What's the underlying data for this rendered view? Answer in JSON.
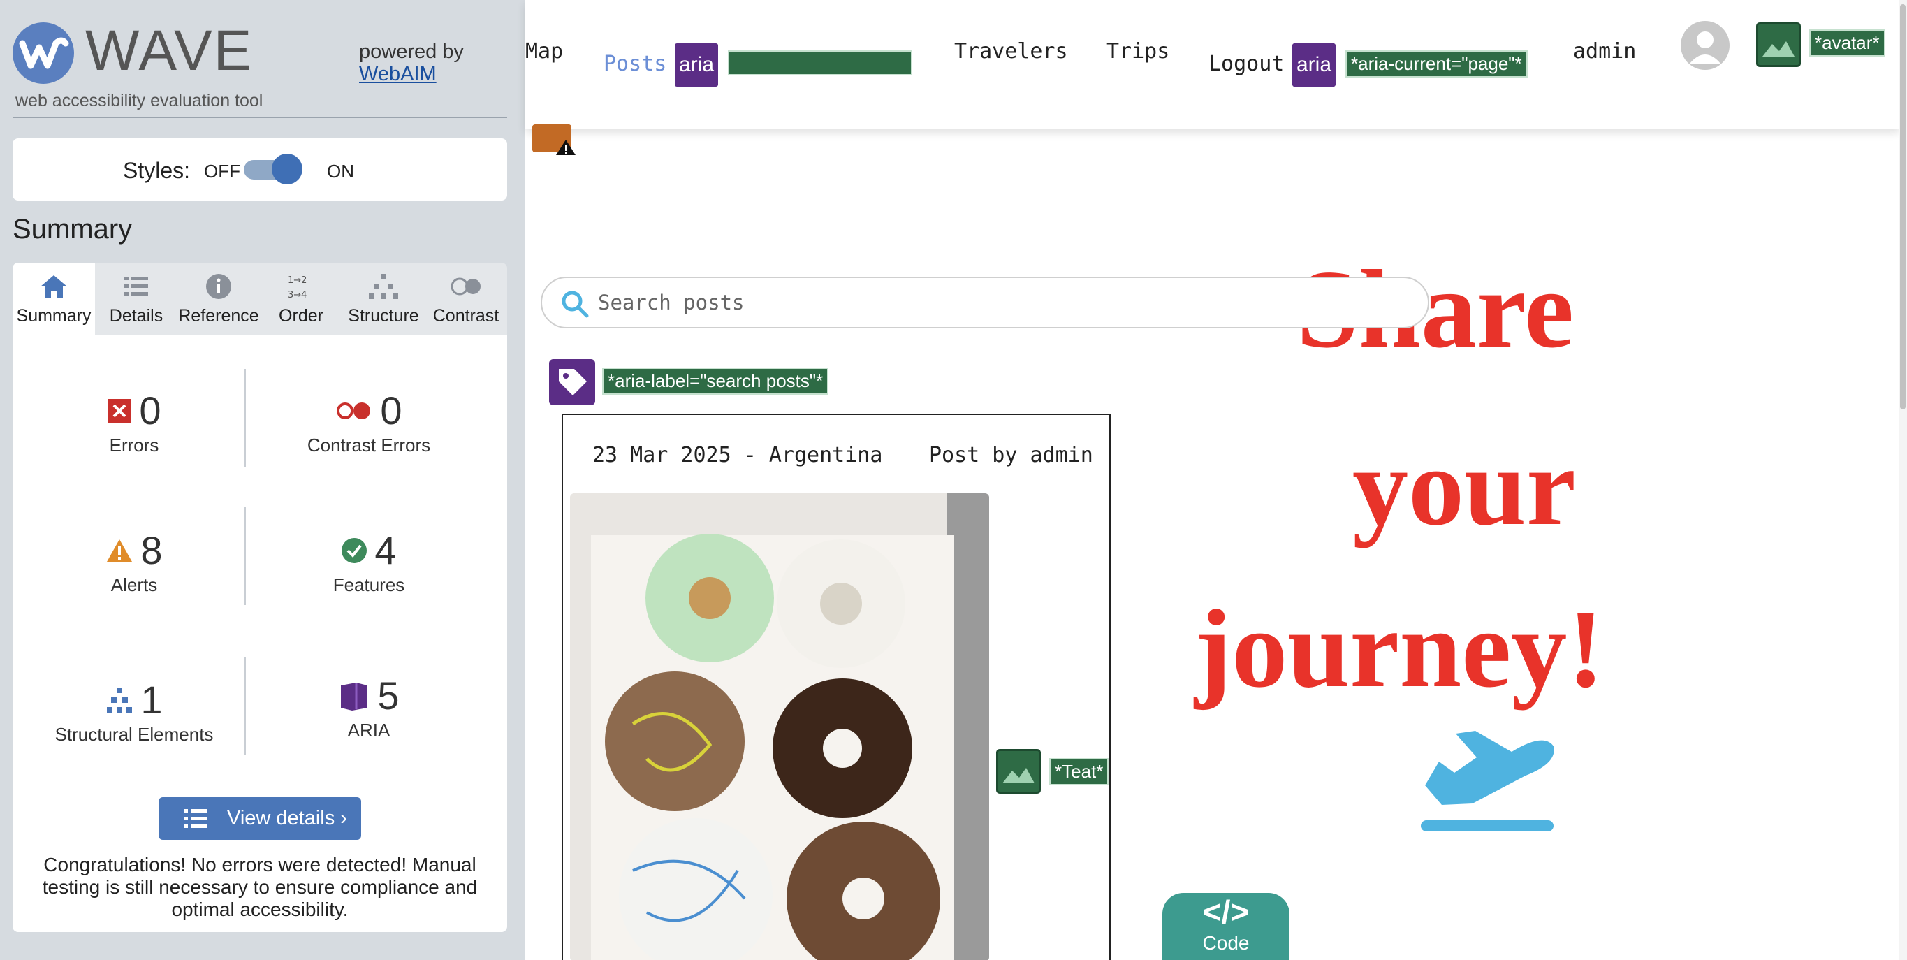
{
  "wave": {
    "brand": "WAVE",
    "tagline": "web accessibility evaluation tool",
    "powered_by": "powered by",
    "webaim_link": "WebAIM",
    "styles_label": "Styles:",
    "styles_off": "OFF",
    "styles_on": "ON",
    "styles_enabled": true,
    "summary_heading": "Summary",
    "tabs": [
      {
        "label": "Summary",
        "icon": "home-icon",
        "active": true
      },
      {
        "label": "Details",
        "icon": "list-icon",
        "active": false
      },
      {
        "label": "Reference",
        "icon": "info-icon",
        "active": false
      },
      {
        "label": "Order",
        "icon": "order-icon",
        "active": false
      },
      {
        "label": "Structure",
        "icon": "structure-icon",
        "active": false
      },
      {
        "label": "Contrast",
        "icon": "contrast-icon",
        "active": false
      }
    ],
    "stats": {
      "errors": {
        "count": "0",
        "label": "Errors"
      },
      "contrast_errors": {
        "count": "0",
        "label": "Contrast Errors"
      },
      "alerts": {
        "count": "8",
        "label": "Alerts"
      },
      "features": {
        "count": "4",
        "label": "Features"
      },
      "structural": {
        "count": "1",
        "label": "Structural Elements"
      },
      "aria": {
        "count": "5",
        "label": "ARIA"
      }
    },
    "view_details": "View details ›",
    "congrats": "Congratulations! No errors were detected! Manual testing is still necessary to ensure compliance and optimal accessibility."
  },
  "site": {
    "nav": {
      "map": "Map",
      "posts": "Posts",
      "travelers": "Travelers",
      "trips": "Trips",
      "logout": "Logout",
      "admin": "admin"
    },
    "aria_badge": "aria",
    "aria_current_tag": "*aria-current=\"page\"*",
    "avatar_tag": "*avatar*",
    "search_placeholder": "Search posts",
    "aria_label_tag": "*aria-label=\"search posts\"*",
    "hero": {
      "line1": "Share",
      "line2": "your",
      "line3": "journey!"
    },
    "post": {
      "date_location": "23 Mar 2025 - Argentina",
      "author": "Post by admin"
    },
    "teat_tag": "*Teat*",
    "code_button": {
      "glyph": "</>",
      "label": "Code"
    }
  },
  "colors": {
    "wave_bg": "#d6dbe0",
    "wave_blue": "#4a76b8",
    "aria_purple": "#5b2d86",
    "feature_green": "#2e6b45",
    "hero_red": "#e8332a",
    "plane_blue": "#4fb3e0",
    "code_teal": "#3d9b8f"
  }
}
